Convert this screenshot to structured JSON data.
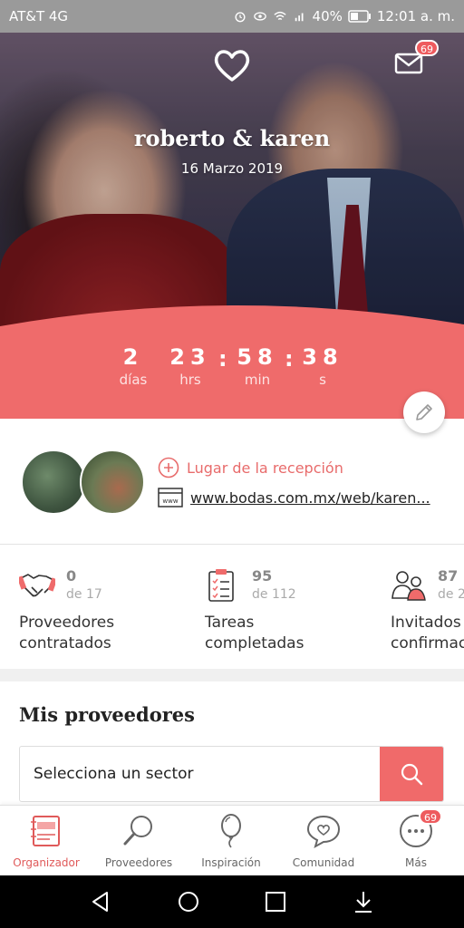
{
  "status_bar": {
    "carrier": "AT&T 4G",
    "battery": "40%",
    "time": "12:01 a. m."
  },
  "header": {
    "couple_name": "roberto & karen",
    "date": "16 Marzo 2019",
    "mail_badge": "69"
  },
  "countdown": {
    "days": "2",
    "days_label": "días",
    "hours": "23",
    "hours_label": "hrs",
    "minutes": "58",
    "minutes_label": "min",
    "seconds": "38",
    "seconds_label": "s"
  },
  "reception": {
    "add_label": "Lugar de la recepción",
    "website": "www.bodas.com.mx/web/karen..."
  },
  "stats": [
    {
      "count": "0",
      "of": "de 17",
      "label_line1": "Proveedores",
      "label_line2": "contratados",
      "icon": "handshake-icon"
    },
    {
      "count": "95",
      "of": "de 112",
      "label_line1": "Tareas",
      "label_line2": "completadas",
      "icon": "clipboard-icon"
    },
    {
      "count": "87",
      "of": "de 2",
      "label_line1": "Invitados",
      "label_line2": "confirmac",
      "icon": "guests-icon"
    }
  ],
  "providers": {
    "title": "Mis proveedores",
    "select_placeholder": "Selecciona un sector"
  },
  "bottom_nav": [
    {
      "label": "Organizador",
      "icon": "planner-icon",
      "active": true
    },
    {
      "label": "Proveedores",
      "icon": "search-icon",
      "active": false
    },
    {
      "label": "Inspiración",
      "icon": "balloon-icon",
      "active": false
    },
    {
      "label": "Comunidad",
      "icon": "chat-heart-icon",
      "active": false
    },
    {
      "label": "Más",
      "icon": "more-icon",
      "active": false,
      "badge": "69"
    }
  ],
  "colors": {
    "accent": "#f06a6a",
    "countdown_bg": "#ef6b6b",
    "status_bar": "#9a9a9a"
  }
}
